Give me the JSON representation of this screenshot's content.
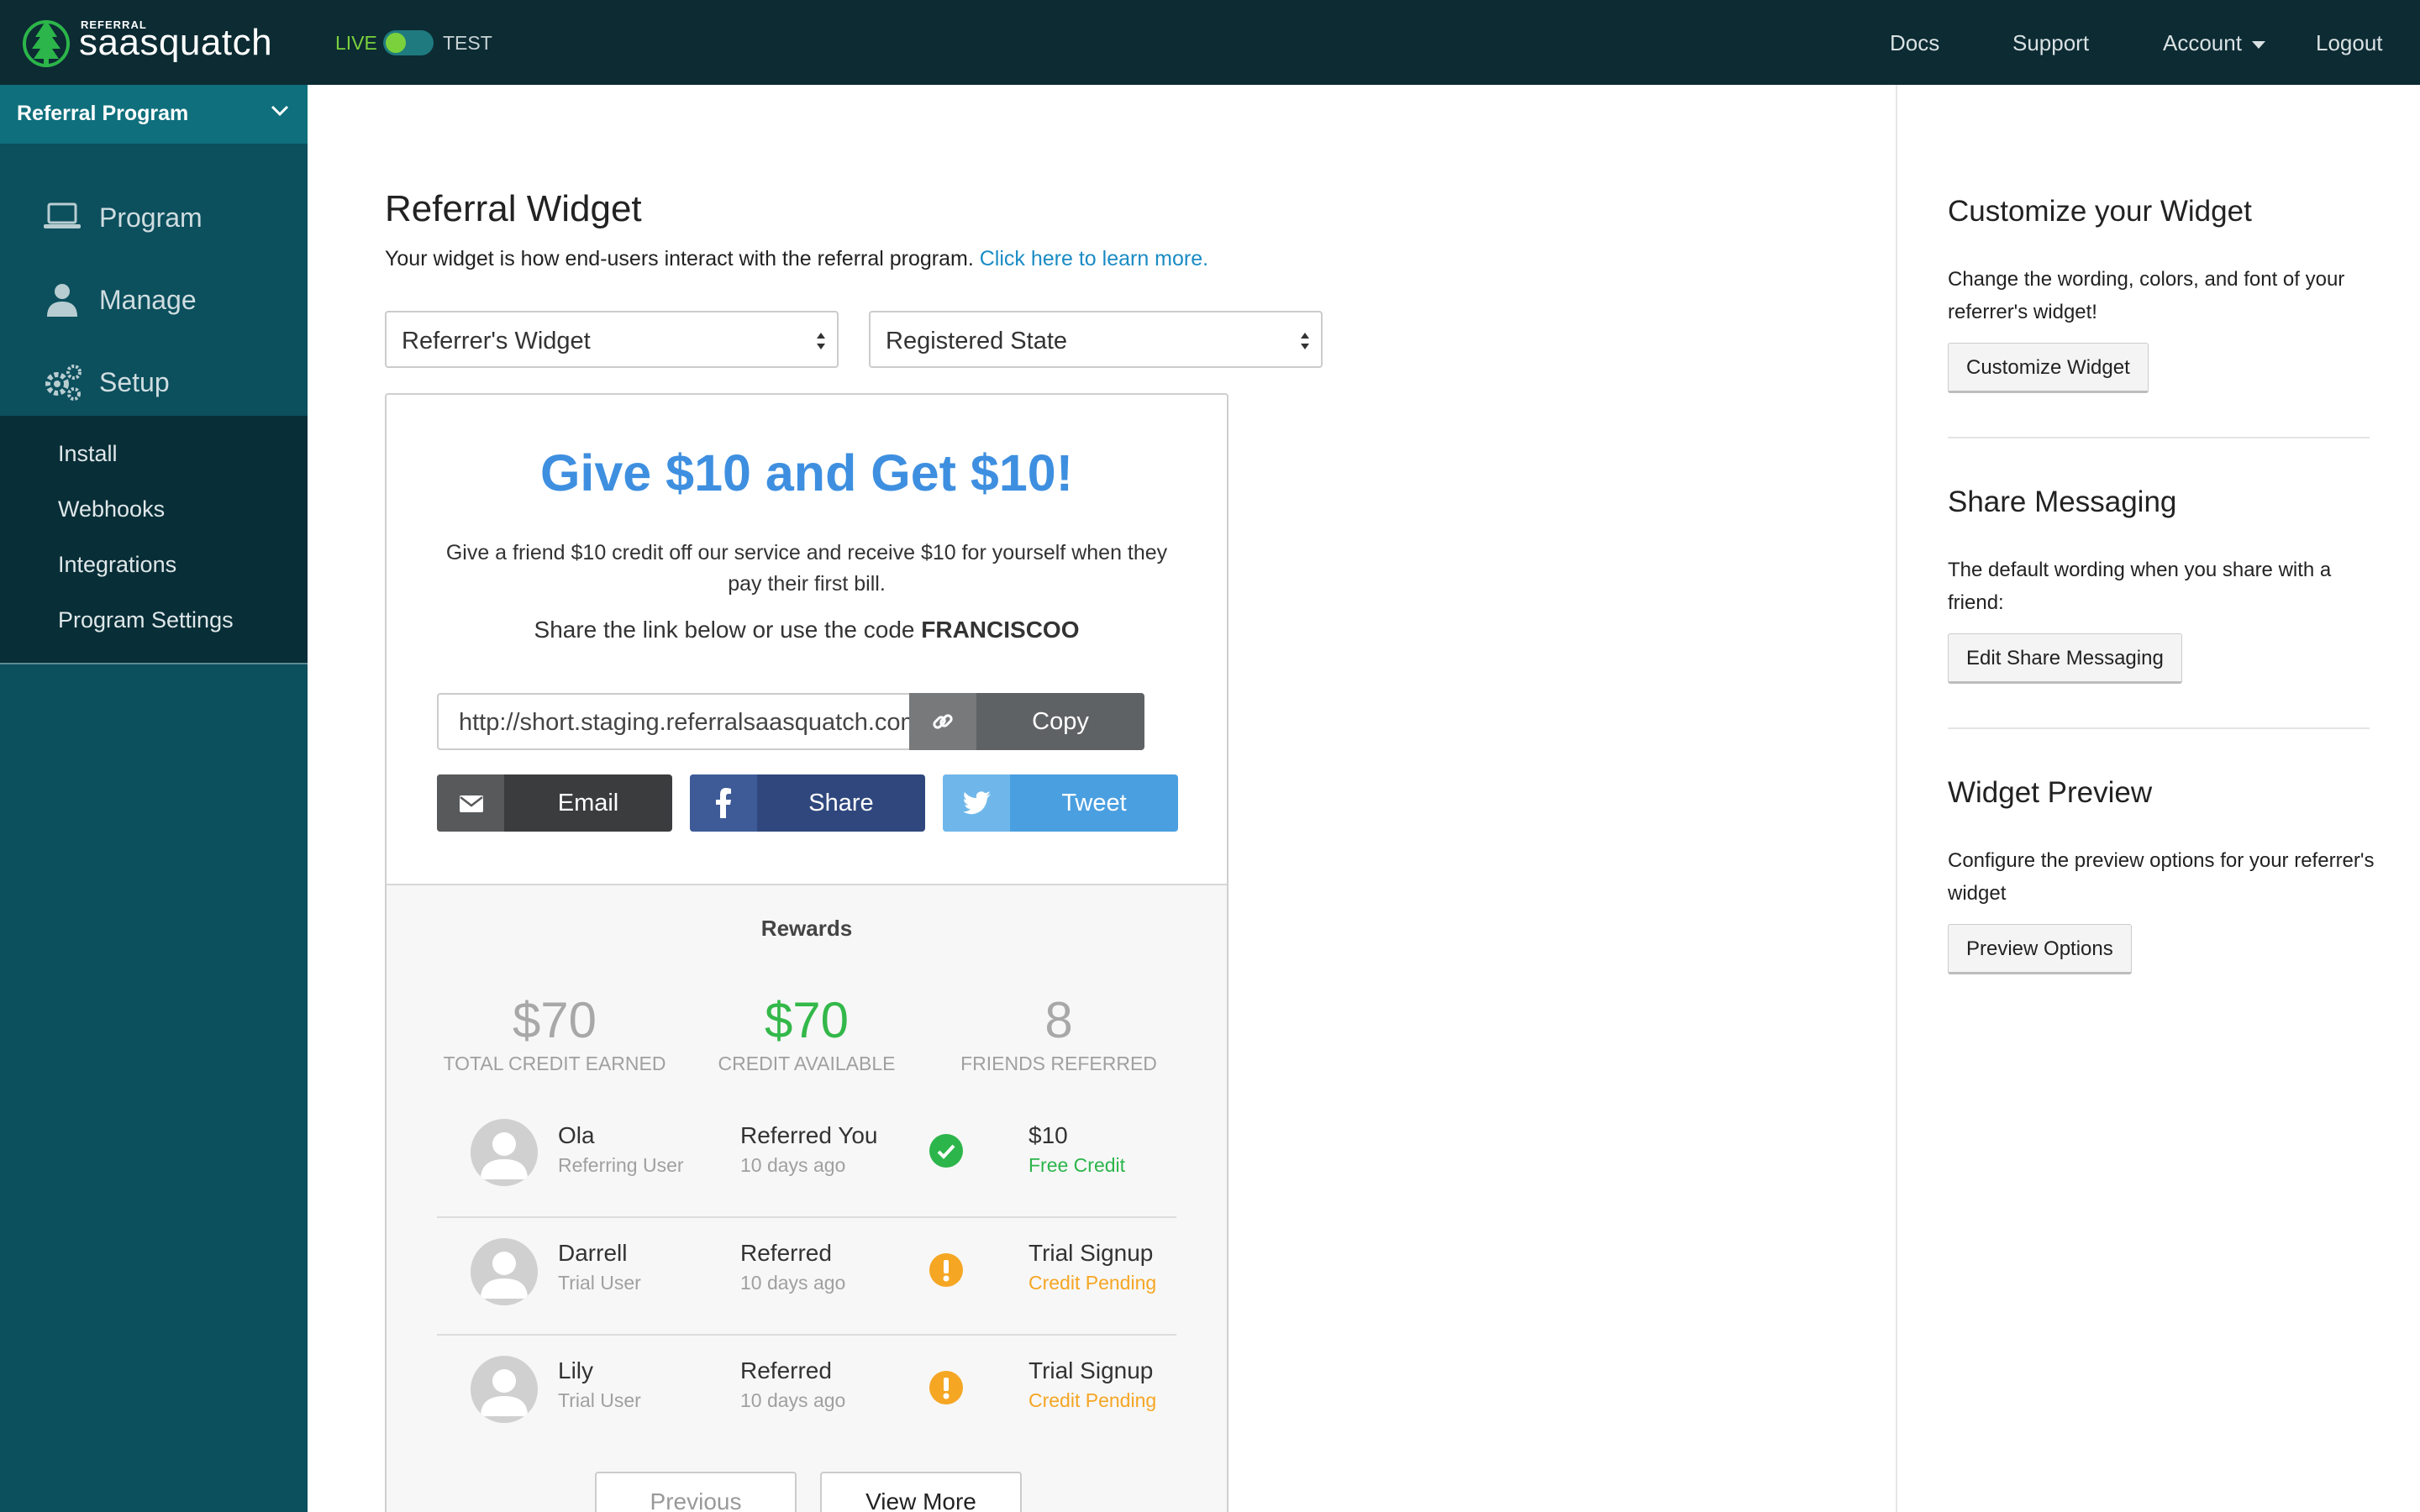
{
  "topbar": {
    "logo_small": "REFERRAL",
    "logo_text": "saasquatch",
    "env_live": "LIVE",
    "env_test": "TEST",
    "nav": {
      "docs": "Docs",
      "support": "Support",
      "account": "Account",
      "logout": "Logout"
    }
  },
  "sidebar": {
    "program_select": "Referral Program",
    "items": {
      "program": {
        "label": "Program",
        "icon": "laptop-icon"
      },
      "manage": {
        "label": "Manage",
        "icon": "user-icon"
      },
      "setup": {
        "label": "Setup",
        "icon": "gears-icon"
      }
    },
    "subitems": [
      "Install",
      "Webhooks",
      "Integrations",
      "Program Settings"
    ]
  },
  "main": {
    "title": "Referral Widget",
    "description": "Your widget is how end-users interact with the referral program.",
    "learn_more": "Click here to learn more.",
    "widget_select": "Referrer's Widget",
    "state_select": "Registered State"
  },
  "widget": {
    "headline": "Give $10 and Get $10!",
    "description": "Give a friend $10 credit off our service and receive $10 for yourself when they pay their first bill.",
    "code_prefix": "Share the link below or use the code",
    "code": "FRANCISCOO",
    "share_link": "http://short.staging.referralsaasquatch.com/",
    "copy_label": "Copy",
    "email_label": "Email",
    "share_label": "Share",
    "tweet_label": "Tweet",
    "rewards_title": "Rewards",
    "stats": [
      {
        "value": "$70",
        "label": "TOTAL CREDIT EARNED"
      },
      {
        "value": "$70",
        "label": "CREDIT AVAILABLE"
      },
      {
        "value": "8",
        "label": "FRIENDS REFERRED"
      }
    ],
    "referrals": [
      {
        "name": "Ola",
        "role": "Referring User",
        "status": "Referred You",
        "time": "10 days ago",
        "reward": "$10",
        "reward_status": "Free Credit"
      },
      {
        "name": "Darrell",
        "role": "Trial User",
        "status": "Referred",
        "time": "10 days ago",
        "reward": "Trial Signup",
        "reward_status": "Credit Pending"
      },
      {
        "name": "Lily",
        "role": "Trial User",
        "status": "Referred",
        "time": "10 days ago",
        "reward": "Trial Signup",
        "reward_status": "Credit Pending"
      }
    ],
    "previous_label": "Previous",
    "view_more_label": "View More"
  },
  "right_panel": {
    "customize": {
      "title": "Customize your Widget",
      "description": "Change the wording, colors, and font of your referrer's widget!",
      "button": "Customize Widget"
    },
    "share_messaging": {
      "title": "Share Messaging",
      "description": "The default wording when you share with a friend:",
      "button": "Edit Share Messaging"
    },
    "preview": {
      "title": "Widget Preview",
      "description": "Configure the preview options for your referrer's widget",
      "button": "Preview Options"
    }
  },
  "colors": {
    "topbar": "#0c2b33",
    "sidebar": "#0c4f5d",
    "accent_blue": "#3e8fe0",
    "success_green": "#2cb54a",
    "pending_orange": "#f5a623"
  }
}
